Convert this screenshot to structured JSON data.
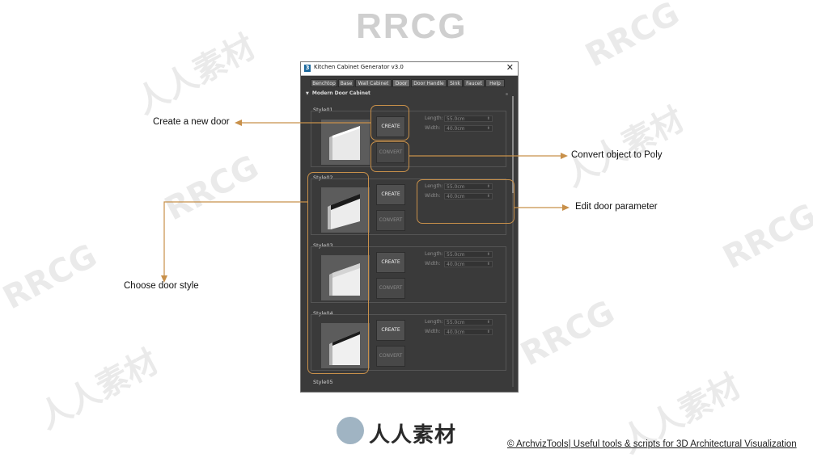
{
  "watermark_top": "RRCG",
  "window": {
    "title": "Kitchen Cabinet Generator v3.0",
    "close_glyph": "✕",
    "app_icon_glyph": "3",
    "tabs": [
      {
        "label": "Benchtop"
      },
      {
        "label": "Base"
      },
      {
        "label": "Wall Cabinet"
      },
      {
        "label": "Door",
        "active": true
      },
      {
        "label": "Door Handle"
      },
      {
        "label": "Sink"
      },
      {
        "label": "Faucet"
      },
      {
        "label": "Help"
      }
    ],
    "rollout_title": "Modern Door Cabinet",
    "styles": [
      {
        "label": "Style01",
        "create": "CREATE",
        "convert": "CONVERT",
        "length_label": "Length:",
        "length_value": "55.0cm",
        "width_label": "Width:",
        "width_value": "40.0cm"
      },
      {
        "label": "Style02",
        "create": "CREATE",
        "convert": "CONVERT",
        "length_label": "Length:",
        "length_value": "55.0cm",
        "width_label": "Width:",
        "width_value": "40.0cm"
      },
      {
        "label": "Style03",
        "create": "CREATE",
        "convert": "CONVERT",
        "length_label": "Length:",
        "length_value": "55.0cm",
        "width_label": "Width:",
        "width_value": "40.0cm"
      },
      {
        "label": "Style04",
        "create": "CREATE",
        "convert": "CONVERT",
        "length_label": "Length:",
        "length_value": "55.0cm",
        "width_label": "Width:",
        "width_value": "40.0cm"
      }
    ],
    "style05_label": "Style05"
  },
  "annotations": {
    "create": "Create a new door",
    "convert": "Convert object to Poly",
    "edit": "Edit door parameter",
    "choose": "Choose door style"
  },
  "footer": "© ArchvizTools| Useful tools & scripts for 3D Architectural Visualization",
  "logo_text": "人人素材",
  "colors": {
    "callout": "#c8904a",
    "panel_bg": "#3a3a3a"
  }
}
